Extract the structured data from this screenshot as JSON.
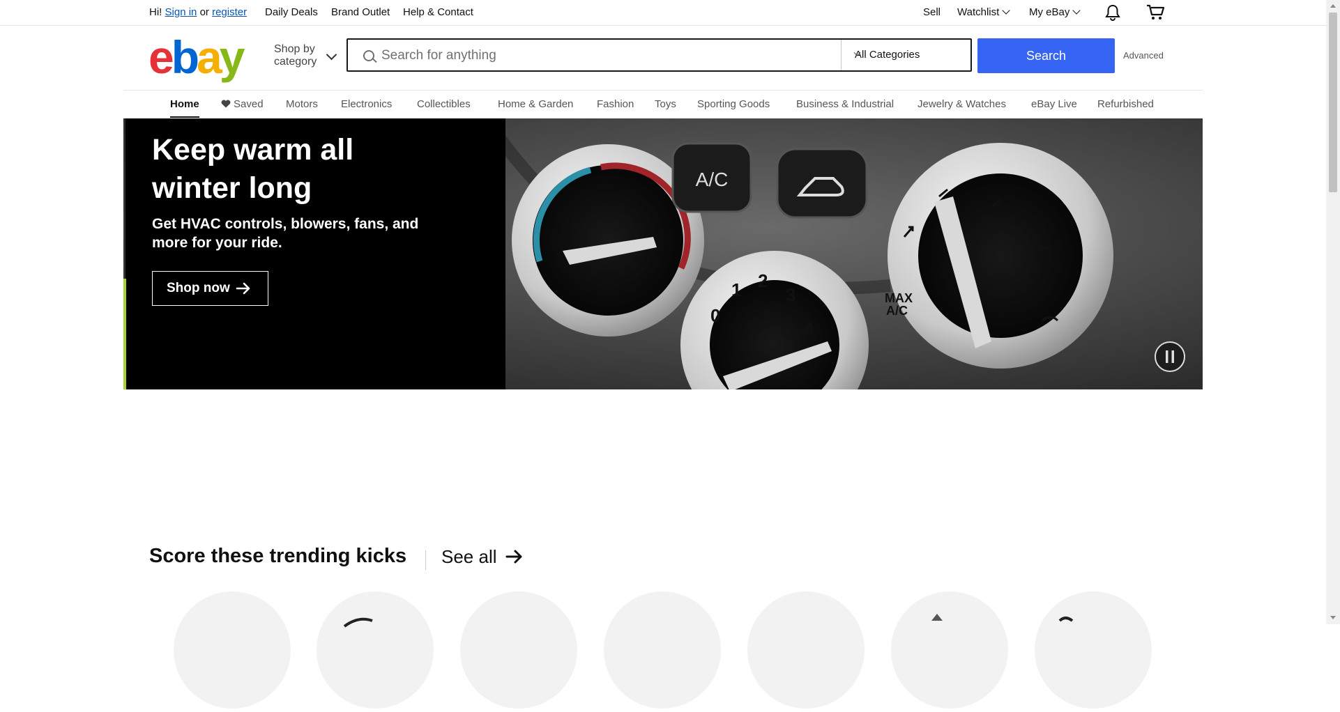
{
  "topbar": {
    "greeting": "Hi!",
    "sign_in": "Sign in",
    "or": "or",
    "register": "register",
    "links": [
      "Daily Deals",
      "Brand Outlet",
      "Help & Contact"
    ],
    "sell": "Sell",
    "watchlist": "Watchlist",
    "my_ebay": "My eBay",
    "icons": [
      "bell-icon",
      "cart-icon"
    ]
  },
  "header": {
    "logo": {
      "e": "e",
      "b": "b",
      "a": "a",
      "y": "y"
    },
    "logo_colors": [
      "#e53238",
      "#0064d2",
      "#f5af02",
      "#86b817"
    ],
    "shop_by_line1": "Shop by",
    "shop_by_line2": "category",
    "search_placeholder": "Search for anything",
    "search_value": "",
    "category_selected": "All Categories",
    "search_button": "Search",
    "advanced": "Advanced",
    "accent_color": "#3665f3"
  },
  "nav": {
    "items": [
      "Home",
      "Saved",
      "Motors",
      "Electronics",
      "Collectibles",
      "Home & Garden",
      "Fashion",
      "Toys",
      "Sporting Goods",
      "Business & Industrial",
      "Jewelry & Watches",
      "eBay Live",
      "Refurbished"
    ],
    "active": "Home"
  },
  "hero": {
    "title": "Keep warm all winter long",
    "subtitle": "Get HVAC controls, blowers, fans, and more for your ride.",
    "cta": "Shop now",
    "image_text": {
      "ac": "A/C",
      "max": "MAX",
      "max_ac": "A/C",
      "dial": [
        "0",
        "1",
        "2",
        "3",
        "4"
      ]
    }
  },
  "trending": {
    "title": "Score these trending kicks",
    "see_all": "See all"
  }
}
